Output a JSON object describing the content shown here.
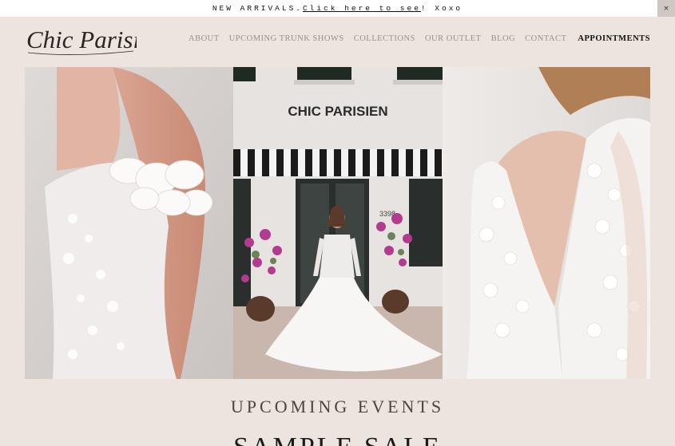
{
  "announcement": {
    "prefix": "NEW ARRIVALS. ",
    "link_text": "Click here to see",
    "suffix": "! Xoxo",
    "close_label": "×"
  },
  "logo": {
    "text": "Chic Parisien"
  },
  "nav": {
    "items": [
      "ABOUT",
      "UPCOMING TRUNK SHOWS",
      "COLLECTIONS",
      "OUR OUTLET",
      "BLOG",
      "CONTACT"
    ],
    "cta": "APPOINTMENTS"
  },
  "storefront": {
    "sign": "CHIC PARISIEN",
    "number": "3398"
  },
  "sections": {
    "events_title": "UPCOMING EVENTS",
    "sample_title": "SAMPLE SALE"
  },
  "colors": {
    "background": "#ede3df",
    "nav_text": "#9a8f8b",
    "awning_stripe": "#1b1b1b"
  }
}
